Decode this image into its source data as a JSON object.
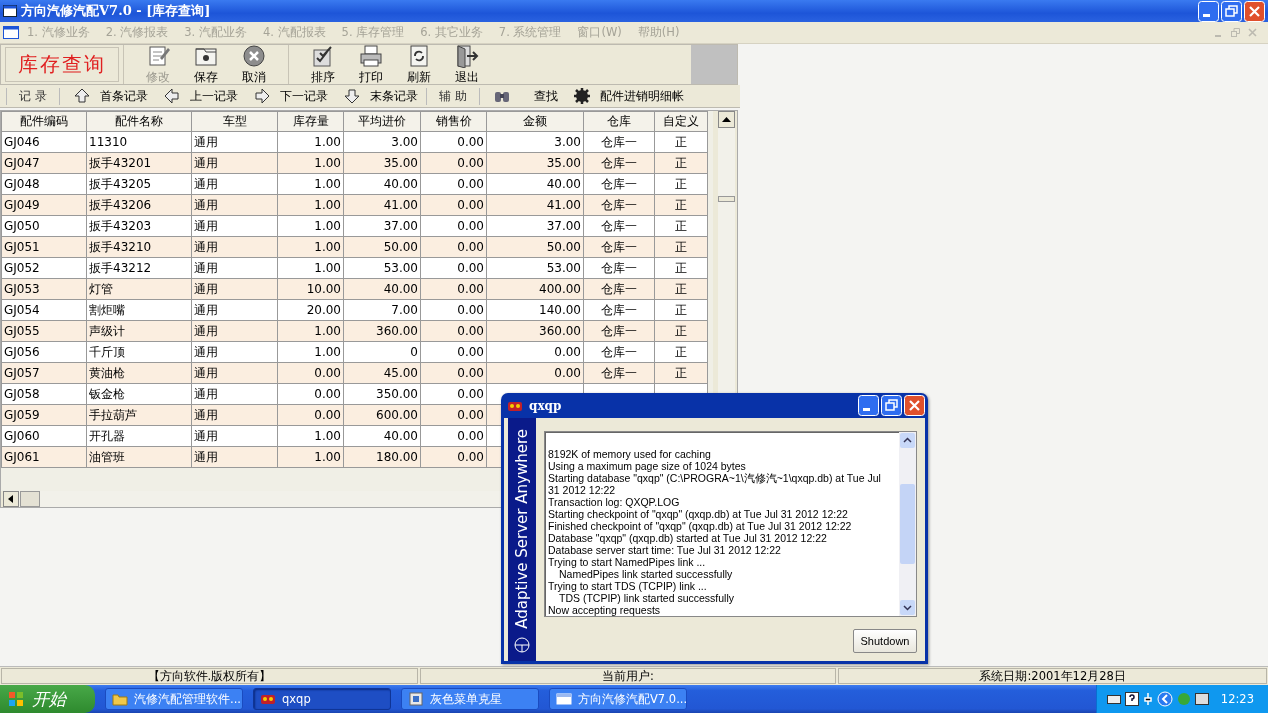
{
  "window": {
    "title": "方向汽修汽配V7.0 - [库存查询]"
  },
  "menu": [
    {
      "label": "1. 汽修业务",
      "disabled": true
    },
    {
      "label": "2. 汽修报表",
      "disabled": true
    },
    {
      "label": "3. 汽配业务",
      "disabled": true
    },
    {
      "label": "4. 汽配报表",
      "disabled": true
    },
    {
      "label": "5. 库存管理",
      "disabled": true
    },
    {
      "label": "6. 其它业务",
      "disabled": true
    },
    {
      "label": "7. 系统管理",
      "disabled": true
    },
    {
      "label": "窗口(W)",
      "disabled": true
    },
    {
      "label": "帮助(H)",
      "disabled": true
    }
  ],
  "toolbar": {
    "caption": "库存查询",
    "buttons": [
      {
        "kind": "edit",
        "label": "修改",
        "disabled": true
      },
      {
        "kind": "save",
        "label": "保存",
        "disabled": false
      },
      {
        "kind": "cancel",
        "label": "取消",
        "disabled": false
      },
      {
        "kind": "sort",
        "label": "排序",
        "disabled": false
      },
      {
        "kind": "print",
        "label": "打印",
        "disabled": false
      },
      {
        "kind": "refresh",
        "label": "刷新",
        "disabled": false
      },
      {
        "kind": "exit",
        "label": "退出",
        "disabled": false
      }
    ]
  },
  "navbar": [
    {
      "kind": "label",
      "label": "记 录"
    },
    {
      "kind": "first",
      "label": "首条记录"
    },
    {
      "kind": "prev",
      "label": "上一记录"
    },
    {
      "kind": "next",
      "label": "下一记录"
    },
    {
      "kind": "last",
      "label": "末条记录"
    },
    {
      "kind": "label",
      "label": "辅 助"
    },
    {
      "kind": "find",
      "label": "查找"
    },
    {
      "kind": "ledger",
      "label": "配件进销明细帐"
    }
  ],
  "table": {
    "columns": [
      {
        "label": "配件编码",
        "kind": "text"
      },
      {
        "label": "配件名称",
        "kind": "text"
      },
      {
        "label": "车型",
        "kind": "text"
      },
      {
        "label": "库存量",
        "kind": "number"
      },
      {
        "label": "平均进价",
        "kind": "number"
      },
      {
        "label": "销售价",
        "kind": "number"
      },
      {
        "label": "金额",
        "kind": "number"
      },
      {
        "label": "仓库",
        "kind": "center"
      },
      {
        "label": "自定义",
        "kind": "center"
      }
    ],
    "rows": [
      {
        "cells": [
          "GJ046",
          "11310",
          "通用",
          "1.00",
          "3.00",
          "0.00",
          "3.00",
          "仓库一",
          "正"
        ]
      },
      {
        "cells": [
          "GJ047",
          "扳手43201",
          "通用",
          "1.00",
          "35.00",
          "0.00",
          "35.00",
          "仓库一",
          "正"
        ]
      },
      {
        "cells": [
          "GJ048",
          "扳手43205",
          "通用",
          "1.00",
          "40.00",
          "0.00",
          "40.00",
          "仓库一",
          "正"
        ]
      },
      {
        "cells": [
          "GJ049",
          "扳手43206",
          "通用",
          "1.00",
          "41.00",
          "0.00",
          "41.00",
          "仓库一",
          "正"
        ]
      },
      {
        "cells": [
          "GJ050",
          "扳手43203",
          "通用",
          "1.00",
          "37.00",
          "0.00",
          "37.00",
          "仓库一",
          "正"
        ]
      },
      {
        "cells": [
          "GJ051",
          "扳手43210",
          "通用",
          "1.00",
          "50.00",
          "0.00",
          "50.00",
          "仓库一",
          "正"
        ]
      },
      {
        "cells": [
          "GJ052",
          "扳手43212",
          "通用",
          "1.00",
          "53.00",
          "0.00",
          "53.00",
          "仓库一",
          "正"
        ]
      },
      {
        "cells": [
          "GJ053",
          "灯管",
          "通用",
          "10.00",
          "40.00",
          "0.00",
          "400.00",
          "仓库一",
          "正"
        ]
      },
      {
        "cells": [
          "GJ054",
          "割炬嘴",
          "通用",
          "20.00",
          "7.00",
          "0.00",
          "140.00",
          "仓库一",
          "正"
        ]
      },
      {
        "cells": [
          "GJ055",
          "声级计",
          "通用",
          "1.00",
          "360.00",
          "0.00",
          "360.00",
          "仓库一",
          "正"
        ]
      },
      {
        "cells": [
          "GJ056",
          "千斤顶",
          "通用",
          "1.00",
          "0",
          "0.00",
          "0.00",
          "仓库一",
          "正"
        ]
      },
      {
        "cells": [
          "GJ057",
          "黄油枪",
          "通用",
          "0.00",
          "45.00",
          "0.00",
          "0.00",
          "仓库一",
          "正"
        ]
      },
      {
        "cells": [
          "GJ058",
          "钣金枪",
          "通用",
          "0.00",
          "350.00",
          "0.00"
        ]
      },
      {
        "cells": [
          "GJ059",
          "手拉葫芦",
          "通用",
          "0.00",
          "600.00",
          "0.00"
        ]
      },
      {
        "cells": [
          "GJ060",
          "开孔器",
          "通用",
          "1.00",
          "40.00",
          "0.00"
        ]
      },
      {
        "cells": [
          "GJ061",
          "油管班",
          "通用",
          "1.00",
          "180.00",
          "0.00"
        ]
      }
    ]
  },
  "status_bar": [
    "【方向软件.版权所有】",
    "当前用户:",
    "系统日期:2001年12月28日"
  ],
  "dialog": {
    "title": "qxqp",
    "side_text": "Adaptive Server Anywhere",
    "button": "Shutdown",
    "log": [
      {
        "text": "8192K of memory used for caching",
        "indent": false
      },
      {
        "text": "Using a maximum page size of 1024 bytes",
        "indent": false
      },
      {
        "text": "Starting database \"qxqp\" (C:\\PROGRA~1\\汽修汽~1\\qxqp.db) at Tue Jul 31 2012 12:22",
        "indent": false
      },
      {
        "text": "Transaction log: QXQP.LOG",
        "indent": false
      },
      {
        "text": "Starting checkpoint of \"qxqp\" (qxqp.db) at Tue Jul 31 2012 12:22",
        "indent": false
      },
      {
        "text": "Finished checkpoint of \"qxqp\" (qxqp.db) at Tue Jul 31 2012 12:22",
        "indent": false
      },
      {
        "text": "Database \"qxqp\" (qxqp.db) started at Tue Jul 31 2012 12:22",
        "indent": false
      },
      {
        "text": "Database server start time: Tue Jul 31 2012 12:22",
        "indent": false
      },
      {
        "text": "Trying to start NamedPipes link ...",
        "indent": false
      },
      {
        "text": "NamedPipes link started successfully",
        "indent": true
      },
      {
        "text": "Trying to start TDS (TCPIP) link ...",
        "indent": false
      },
      {
        "text": "TDS (TCPIP) link started successfully",
        "indent": true
      },
      {
        "text": "Now accepting requests",
        "indent": false
      }
    ]
  },
  "taskbar": {
    "start": "开始",
    "clock": "12:23",
    "items": [
      {
        "kind": "folder",
        "label": "汽修汽配管理软件...",
        "selected": false
      },
      {
        "kind": "server",
        "label": "qxqp",
        "selected": true
      },
      {
        "kind": "app",
        "label": "灰色菜单克星",
        "selected": false
      },
      {
        "kind": "window",
        "label": "方向汽修汽配V7.0...",
        "selected": false
      }
    ]
  }
}
